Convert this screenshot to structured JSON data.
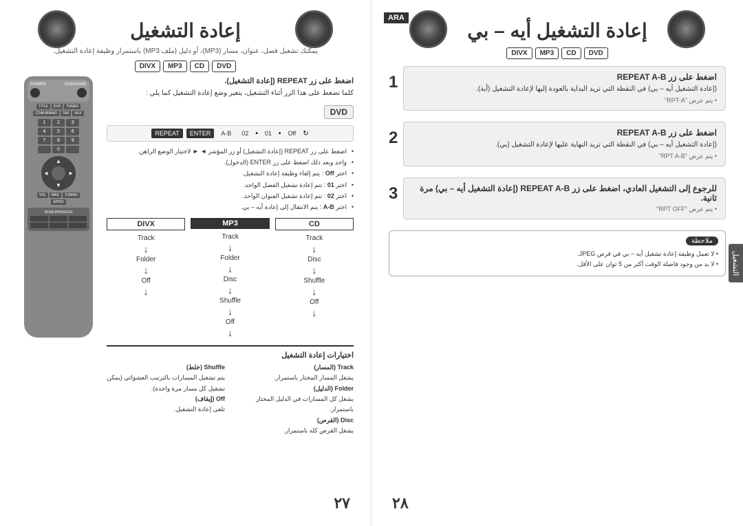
{
  "pages": {
    "right": {
      "title": "إعادة التشغيل",
      "subtitle": "يمكنك تشغيل فصل، عنوان، مسار (MP3)، أو دليل (ملف MP3) باستمرار وظيفة إعادة التشغيل.",
      "formats": [
        "DIVX",
        "MP3",
        "CD",
        "DVD"
      ],
      "instruction_title": "اضغط على زر REPEAT (إعادة التشغيل).",
      "instruction_note": "كلما تضغط على هذا الزر أثناء التشغيل، يتغير وضع إعادة التشغيل كما يلي :",
      "dvd_label": "DVD",
      "mode_bar": [
        "Off",
        "01",
        "02",
        "A-B",
        "ENTER",
        "REPEAT"
      ],
      "bullets": [
        "اضغط على زر REPEAT (إعادة التشغيل) أو زر المؤشر ◄ ► لاختيار الوضع الراهن.",
        "واحد وبعد ذلك اضغط على زر ENTER (الدخول).",
        "اختر Off : يتم إلغاء وظيفة إعادة التشغيل.",
        "اختر 01 : تتم إعادة تشغيل الفصل الواحد.",
        "اختر 02 : تتم إعادة تشغيل العنوان الواحد.",
        "اختر A-B : يتم الانتقال إلى إعادة أيه – بي."
      ],
      "repeat_cols": [
        {
          "title": "CD",
          "items": [
            "Track",
            "Disc",
            "Shuffle",
            "Off"
          ],
          "arrow": "↓"
        },
        {
          "title": "MP3",
          "items": [
            "Track",
            "Folder",
            "Disc",
            "Shuffle",
            "Off"
          ],
          "arrow": "↓"
        },
        {
          "title": "DIVX",
          "items": [
            "Track",
            "Folder",
            "Off"
          ],
          "arrow": "↓"
        }
      ],
      "glossary": {
        "title": "اختيارات إعادة التشغيل",
        "items": [
          {
            "term": "Track (المسار)",
            "desc": "يشغل المسار المختار باستمرار."
          },
          {
            "term": "Folder (الدليل)",
            "desc": "يشغل كل المسارات في الدليل المختار باستمرار."
          },
          {
            "term": "Disc (القرص)",
            "desc": "يشغل القرص كله باستمرار."
          },
          {
            "term": "Shuffle (خلط)",
            "desc": "يتم تشغيل المسارات بالترتيب العشوائي (يمكن تشغيل كل مسار مرة واحدة)."
          },
          {
            "term": "Off (إيقاف)",
            "desc": "تلغى إعادة التشغيل."
          }
        ]
      },
      "page_num": "٢٧"
    },
    "left": {
      "title": "إعادة التشغيل أيه – بي",
      "ara_label": "ARA",
      "formats": [
        "DIVX",
        "MP3",
        "CD",
        "DVD"
      ],
      "steps": [
        {
          "number": "1",
          "title": "اضغط على زر REPEAT A-B",
          "text": "(إعادة التشغيل أيه – بي) في النقطة التي تريد البداية بالعودة إليها لإعادة التشغيل (أية).",
          "display": "• يتم عرض \"RPT-A\""
        },
        {
          "number": "2",
          "title": "اضغط على زر REPEAT A-B",
          "text": "(إعادة التشغيل أيه – بي) في النقطة التي تريد النهاية عليها لإعادة التشغيل (بي).",
          "display": "• يتم عرض \"RPT A-B\""
        },
        {
          "number": "3",
          "title": "للرجوع إلى التشغيل العادي، اضغط على زر REPEAT A-B (إعادة التشغيل أيه – بي) مرة ثانية.",
          "text": "",
          "display": "• يتم عرض \"RPT OFF\""
        }
      ],
      "note_label": "ملاحظة",
      "notes": [
        "لا تعمل وظيفة إعادة تشغيل أيه – بي في قرص JPEG.",
        "لا بد من وجود فاصلة الوقت أكثر من 5 ثوان على الأقل."
      ],
      "side_tab": "التشغيل",
      "page_num": "٢٨"
    }
  }
}
